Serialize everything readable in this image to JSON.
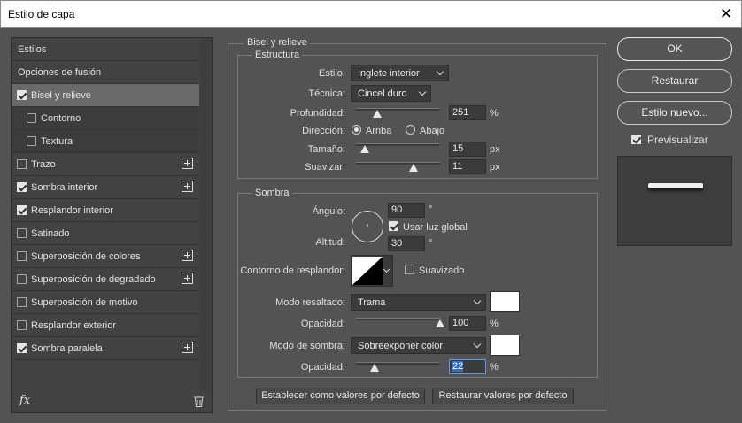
{
  "window": {
    "title": "Estilo de capa",
    "close_glyph": "✕"
  },
  "styles": {
    "header": "Estilos",
    "blend_options": "Opciones de fusión",
    "items": [
      {
        "label": "Bisel y relieve",
        "checked": true,
        "selected": true,
        "plus": false
      },
      {
        "label": "Contorno",
        "checked": false,
        "sub": true,
        "plus": false
      },
      {
        "label": "Textura",
        "checked": false,
        "sub": true,
        "plus": false
      },
      {
        "label": "Trazo",
        "checked": false,
        "plus": true
      },
      {
        "label": "Sombra interior",
        "checked": true,
        "plus": true
      },
      {
        "label": "Resplandor interior",
        "checked": true,
        "plus": false
      },
      {
        "label": "Satinado",
        "checked": false,
        "plus": false
      },
      {
        "label": "Superposición de colores",
        "checked": false,
        "plus": true
      },
      {
        "label": "Superposición de degradado",
        "checked": false,
        "plus": true
      },
      {
        "label": "Superposición de motivo",
        "checked": false,
        "plus": false
      },
      {
        "label": "Resplandor exterior",
        "checked": false,
        "plus": false
      },
      {
        "label": "Sombra paralela",
        "checked": true,
        "plus": true
      }
    ],
    "fx_label": "fx"
  },
  "bevel": {
    "group_title": "Bisel y relieve",
    "structure_title": "Estructura",
    "style_label": "Estilo:",
    "style_value": "Inglete interior",
    "technique_label": "Técnica:",
    "technique_value": "Cincel duro",
    "depth_label": "Profundidad:",
    "depth_value": "251",
    "depth_unit": "%",
    "depth_fraction": 0.25,
    "direction_label": "Dirección:",
    "dir_up": "Arriba",
    "dir_down": "Abajo",
    "size_label": "Tamaño:",
    "size_value": "15",
    "size_unit": "px",
    "size_fraction": 0.1,
    "soften_label": "Suavizar:",
    "soften_value": "11",
    "soften_unit": "px",
    "soften_fraction": 0.68
  },
  "shading": {
    "title": "Sombra",
    "angle_label": "Ángulo:",
    "angle_value": "90",
    "angle_unit": "°",
    "global_light_label": "Usar luz global",
    "global_light_checked": true,
    "altitude_label": "Altitud:",
    "altitude_value": "30",
    "altitude_unit": "°",
    "gloss_label": "Contorno de resplandor:",
    "antialiased_label": "Suavizado",
    "antialiased_checked": false,
    "highlight_mode_label": "Modo resaltado:",
    "highlight_mode_value": "Trama",
    "highlight_opacity_label": "Opacidad:",
    "highlight_opacity_value": "100",
    "highlight_opacity_unit": "%",
    "highlight_fraction": 1.0,
    "shadow_mode_label": "Modo de sombra:",
    "shadow_mode_value": "Sobreexponer color",
    "shadow_opacity_label": "Opacidad:",
    "shadow_opacity_value": "22",
    "shadow_opacity_unit": "%",
    "shadow_fraction": 0.22,
    "highlight_color": "#ffffff",
    "shadow_color": "#ffffff"
  },
  "bottom": {
    "make_default": "Establecer como valores por defecto",
    "reset_default": "Restaurar valores por defecto"
  },
  "right": {
    "ok": "OK",
    "reset": "Restaurar",
    "new_style": "Estilo nuevo...",
    "preview_label": "Previsualizar",
    "preview_checked": true
  }
}
